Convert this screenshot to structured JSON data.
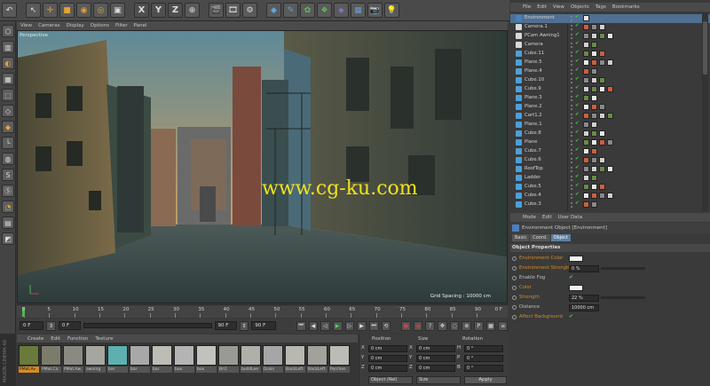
{
  "toolbar": {
    "icons": [
      "undo-icon",
      "select-icon",
      "move-icon",
      "scale-icon",
      "rotate-icon",
      "recent-icon",
      "x-axis",
      "y-axis",
      "z-axis",
      "coord-system-icon",
      "render-view-icon",
      "render-picture-icon",
      "render-settings-icon",
      "cube-icon",
      "pen-icon",
      "subdivision-icon",
      "array-icon",
      "deformer-icon",
      "floor-icon",
      "camera-icon",
      "light-icon"
    ],
    "axis_x": "X",
    "axis_y": "Y",
    "axis_z": "Z"
  },
  "viewport": {
    "menu": [
      "View",
      "Cameras",
      "Display",
      "Options",
      "Filter",
      "Panel"
    ],
    "label": "Perspective",
    "grid_spacing": "Grid Spacing : 10000 cm",
    "watermark": "www.cg-ku.com"
  },
  "timeline": {
    "ticks": [
      "0",
      "5",
      "10",
      "15",
      "20",
      "25",
      "30",
      "35",
      "40",
      "45",
      "50",
      "55",
      "60",
      "65",
      "70",
      "75",
      "80",
      "85",
      "90"
    ],
    "end_label": "0 F",
    "current_frame": "0 F",
    "start_field": "0 F",
    "range_start": "0 F",
    "range_end": "90 F",
    "end_field": "90 F"
  },
  "materials": {
    "menu": [
      "Create",
      "Edit",
      "Function",
      "Texture"
    ],
    "items": [
      {
        "name": "PMat.Av",
        "color": "#6a7a3a",
        "selected": true
      },
      {
        "name": "PMat.Ca",
        "color": "#7c7c6c",
        "selected": false
      },
      {
        "name": "PMat.Aw",
        "color": "#8a8a82",
        "selected": false
      },
      {
        "name": "awning",
        "color": "#a6a6a0",
        "selected": false
      },
      {
        "name": "bar",
        "color": "#5eb0b0",
        "selected": false
      },
      {
        "name": "bar",
        "color": "#a8a8a8",
        "selected": false
      },
      {
        "name": "bar",
        "color": "#bdbdb6",
        "selected": false
      },
      {
        "name": "box",
        "color": "#b4b4b4",
        "selected": false
      },
      {
        "name": "box",
        "color": "#c2c2bc",
        "selected": false
      },
      {
        "name": "Bri1",
        "color": "#9a9a94",
        "selected": false
      },
      {
        "name": "buildLee",
        "color": "#b0b0aa",
        "selected": false
      },
      {
        "name": "Drain",
        "color": "#a6a6a6",
        "selected": false
      },
      {
        "name": "BackLeft",
        "color": "#b8b8b0",
        "selected": false
      },
      {
        "name": "BackLeft",
        "color": "#a2a29a",
        "selected": false
      },
      {
        "name": "Porches",
        "color": "#bcbcb6",
        "selected": false
      }
    ],
    "brand": "MAXON CINEMA 4D"
  },
  "coordinates": {
    "headers": [
      "Position",
      "Size",
      "Rotation"
    ],
    "rows": [
      {
        "axis": "X",
        "pos": "0 cm",
        "size_axis": "X",
        "size": "0 cm",
        "rot_axis": "H",
        "rot": "0 °"
      },
      {
        "axis": "Y",
        "pos": "0 cm",
        "size_axis": "Y",
        "size": "0 cm",
        "rot_axis": "P",
        "rot": "0 °"
      },
      {
        "axis": "Z",
        "pos": "0 cm",
        "size_axis": "Z",
        "size": "0 cm",
        "rot_axis": "B",
        "rot": "0 °"
      }
    ],
    "mode_select": "Object (Rel)",
    "size_select": "Size",
    "apply": "Apply"
  },
  "object_manager": {
    "menu": [
      "File",
      "Edit",
      "View",
      "Objects",
      "Tags",
      "Bookmarks"
    ],
    "objects": [
      {
        "name": "Environment",
        "icon": "#4a7fc0",
        "selected": true
      },
      {
        "name": "Camera.1",
        "icon": "#d8d8d8",
        "selected": false
      },
      {
        "name": "PCam Awning1",
        "icon": "#d8d8d8",
        "selected": false
      },
      {
        "name": "Camera",
        "icon": "#d8d8d8",
        "selected": false
      },
      {
        "name": "Cube.11",
        "icon": "#4aa0d8",
        "selected": false
      },
      {
        "name": "Plane.5",
        "icon": "#4aa0d8",
        "selected": false
      },
      {
        "name": "Plane.4",
        "icon": "#4aa0d8",
        "selected": false
      },
      {
        "name": "Cube.10",
        "icon": "#4aa0d8",
        "selected": false
      },
      {
        "name": "Cube.9",
        "icon": "#4aa0d8",
        "selected": false
      },
      {
        "name": "Plane.3",
        "icon": "#4aa0d8",
        "selected": false
      },
      {
        "name": "Plane.2",
        "icon": "#4aa0d8",
        "selected": false
      },
      {
        "name": "Cart1.2",
        "icon": "#4aa0d8",
        "selected": false
      },
      {
        "name": "Plane.1",
        "icon": "#4aa0d8",
        "selected": false
      },
      {
        "name": "Cube.8",
        "icon": "#4aa0d8",
        "selected": false
      },
      {
        "name": "Plane",
        "icon": "#4aa0d8",
        "selected": false
      },
      {
        "name": "Cube.7",
        "icon": "#4aa0d8",
        "selected": false
      },
      {
        "name": "Cube.6",
        "icon": "#4aa0d8",
        "selected": false
      },
      {
        "name": "RoofTop",
        "icon": "#4aa0d8",
        "selected": false
      },
      {
        "name": "Ladder",
        "icon": "#4aa0d8",
        "selected": false
      },
      {
        "name": "Cube.5",
        "icon": "#4aa0d8",
        "selected": false
      },
      {
        "name": "Cube.4",
        "icon": "#4aa0d8",
        "selected": false
      },
      {
        "name": "Cube.3",
        "icon": "#4aa0d8",
        "selected": false
      }
    ]
  },
  "attribute_manager": {
    "menu": [
      "Mode",
      "Edit",
      "User Data"
    ],
    "object_title": "Environment Object [Environment]",
    "tabs": [
      {
        "label": "Basic",
        "active": false
      },
      {
        "label": "Coord.",
        "active": false
      },
      {
        "label": "Object",
        "active": true
      }
    ],
    "section": "Object Properties",
    "props": [
      {
        "label": "Environment Color",
        "type": "swatch",
        "value": "",
        "color": "#f1f1f1",
        "orange": true
      },
      {
        "label": "Environment Strength",
        "type": "field",
        "value": "0 %",
        "orange": true
      },
      {
        "label": "Enable Fog",
        "type": "check",
        "value": "✔",
        "orange": false
      },
      {
        "label": "Color",
        "type": "swatch",
        "value": "",
        "color": "#f1f1f1",
        "orange": true
      },
      {
        "label": "Strength",
        "type": "field",
        "value": "22 %",
        "orange": true
      },
      {
        "label": "Distance",
        "type": "field",
        "value": "10000 cm",
        "orange": false
      },
      {
        "label": "Affect Background",
        "type": "check",
        "value": "✔",
        "orange": true
      }
    ]
  },
  "colors": {
    "accent": "#5d7fa6",
    "selected_material": "#d68b24",
    "orange_label": "#d68b24",
    "playhead": "#3ec23e",
    "watermark": "#f2e21a"
  }
}
